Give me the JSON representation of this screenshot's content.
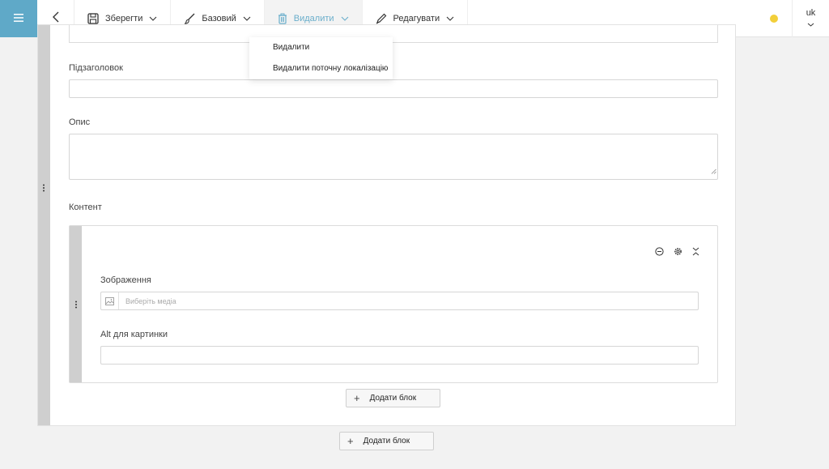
{
  "toolbar": {
    "menu_icon": "hamburger-icon",
    "back_icon": "chevron-left-icon",
    "save_label": "Зберегти",
    "base_label": "Базовий",
    "delete_label": "Видалити",
    "edit_label": "Редагувати"
  },
  "status": {
    "color": "#f2cf3a"
  },
  "lang": {
    "code": "uk"
  },
  "delete_menu": {
    "items": [
      {
        "label": "Видалити"
      },
      {
        "label": "Видалити поточну локалізацію"
      }
    ]
  },
  "form": {
    "subtitle_label": "Підзаголовок",
    "description_label": "Опис",
    "content_label": "Контент"
  },
  "block": {
    "image_label": "Зображення",
    "image_placeholder": "Виберіть медіа",
    "alt_label": "Alt для картинки",
    "add_block_label": "Додати блок"
  },
  "page": {
    "add_block_label": "Додати блок"
  },
  "colors": {
    "accent": "#5fa9c8",
    "status": "#f2cf3a"
  }
}
